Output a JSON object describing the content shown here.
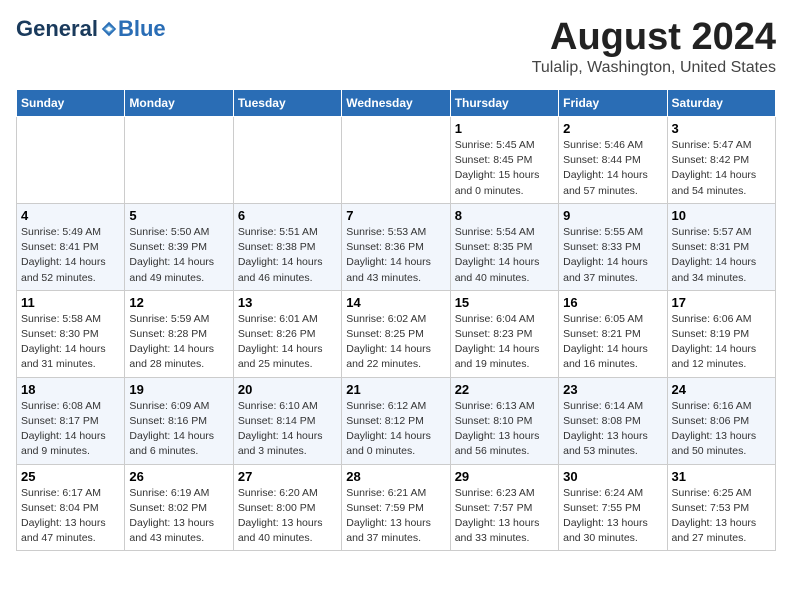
{
  "header": {
    "logo_general": "General",
    "logo_blue": "Blue",
    "month_title": "August 2024",
    "location": "Tulalip, Washington, United States"
  },
  "weekdays": [
    "Sunday",
    "Monday",
    "Tuesday",
    "Wednesday",
    "Thursday",
    "Friday",
    "Saturday"
  ],
  "weeks": [
    [
      {
        "day": "",
        "info": ""
      },
      {
        "day": "",
        "info": ""
      },
      {
        "day": "",
        "info": ""
      },
      {
        "day": "",
        "info": ""
      },
      {
        "day": "1",
        "info": "Sunrise: 5:45 AM\nSunset: 8:45 PM\nDaylight: 15 hours\nand 0 minutes."
      },
      {
        "day": "2",
        "info": "Sunrise: 5:46 AM\nSunset: 8:44 PM\nDaylight: 14 hours\nand 57 minutes."
      },
      {
        "day": "3",
        "info": "Sunrise: 5:47 AM\nSunset: 8:42 PM\nDaylight: 14 hours\nand 54 minutes."
      }
    ],
    [
      {
        "day": "4",
        "info": "Sunrise: 5:49 AM\nSunset: 8:41 PM\nDaylight: 14 hours\nand 52 minutes."
      },
      {
        "day": "5",
        "info": "Sunrise: 5:50 AM\nSunset: 8:39 PM\nDaylight: 14 hours\nand 49 minutes."
      },
      {
        "day": "6",
        "info": "Sunrise: 5:51 AM\nSunset: 8:38 PM\nDaylight: 14 hours\nand 46 minutes."
      },
      {
        "day": "7",
        "info": "Sunrise: 5:53 AM\nSunset: 8:36 PM\nDaylight: 14 hours\nand 43 minutes."
      },
      {
        "day": "8",
        "info": "Sunrise: 5:54 AM\nSunset: 8:35 PM\nDaylight: 14 hours\nand 40 minutes."
      },
      {
        "day": "9",
        "info": "Sunrise: 5:55 AM\nSunset: 8:33 PM\nDaylight: 14 hours\nand 37 minutes."
      },
      {
        "day": "10",
        "info": "Sunrise: 5:57 AM\nSunset: 8:31 PM\nDaylight: 14 hours\nand 34 minutes."
      }
    ],
    [
      {
        "day": "11",
        "info": "Sunrise: 5:58 AM\nSunset: 8:30 PM\nDaylight: 14 hours\nand 31 minutes."
      },
      {
        "day": "12",
        "info": "Sunrise: 5:59 AM\nSunset: 8:28 PM\nDaylight: 14 hours\nand 28 minutes."
      },
      {
        "day": "13",
        "info": "Sunrise: 6:01 AM\nSunset: 8:26 PM\nDaylight: 14 hours\nand 25 minutes."
      },
      {
        "day": "14",
        "info": "Sunrise: 6:02 AM\nSunset: 8:25 PM\nDaylight: 14 hours\nand 22 minutes."
      },
      {
        "day": "15",
        "info": "Sunrise: 6:04 AM\nSunset: 8:23 PM\nDaylight: 14 hours\nand 19 minutes."
      },
      {
        "day": "16",
        "info": "Sunrise: 6:05 AM\nSunset: 8:21 PM\nDaylight: 14 hours\nand 16 minutes."
      },
      {
        "day": "17",
        "info": "Sunrise: 6:06 AM\nSunset: 8:19 PM\nDaylight: 14 hours\nand 12 minutes."
      }
    ],
    [
      {
        "day": "18",
        "info": "Sunrise: 6:08 AM\nSunset: 8:17 PM\nDaylight: 14 hours\nand 9 minutes."
      },
      {
        "day": "19",
        "info": "Sunrise: 6:09 AM\nSunset: 8:16 PM\nDaylight: 14 hours\nand 6 minutes."
      },
      {
        "day": "20",
        "info": "Sunrise: 6:10 AM\nSunset: 8:14 PM\nDaylight: 14 hours\nand 3 minutes."
      },
      {
        "day": "21",
        "info": "Sunrise: 6:12 AM\nSunset: 8:12 PM\nDaylight: 14 hours\nand 0 minutes."
      },
      {
        "day": "22",
        "info": "Sunrise: 6:13 AM\nSunset: 8:10 PM\nDaylight: 13 hours\nand 56 minutes."
      },
      {
        "day": "23",
        "info": "Sunrise: 6:14 AM\nSunset: 8:08 PM\nDaylight: 13 hours\nand 53 minutes."
      },
      {
        "day": "24",
        "info": "Sunrise: 6:16 AM\nSunset: 8:06 PM\nDaylight: 13 hours\nand 50 minutes."
      }
    ],
    [
      {
        "day": "25",
        "info": "Sunrise: 6:17 AM\nSunset: 8:04 PM\nDaylight: 13 hours\nand 47 minutes."
      },
      {
        "day": "26",
        "info": "Sunrise: 6:19 AM\nSunset: 8:02 PM\nDaylight: 13 hours\nand 43 minutes."
      },
      {
        "day": "27",
        "info": "Sunrise: 6:20 AM\nSunset: 8:00 PM\nDaylight: 13 hours\nand 40 minutes."
      },
      {
        "day": "28",
        "info": "Sunrise: 6:21 AM\nSunset: 7:59 PM\nDaylight: 13 hours\nand 37 minutes."
      },
      {
        "day": "29",
        "info": "Sunrise: 6:23 AM\nSunset: 7:57 PM\nDaylight: 13 hours\nand 33 minutes."
      },
      {
        "day": "30",
        "info": "Sunrise: 6:24 AM\nSunset: 7:55 PM\nDaylight: 13 hours\nand 30 minutes."
      },
      {
        "day": "31",
        "info": "Sunrise: 6:25 AM\nSunset: 7:53 PM\nDaylight: 13 hours\nand 27 minutes."
      }
    ]
  ]
}
